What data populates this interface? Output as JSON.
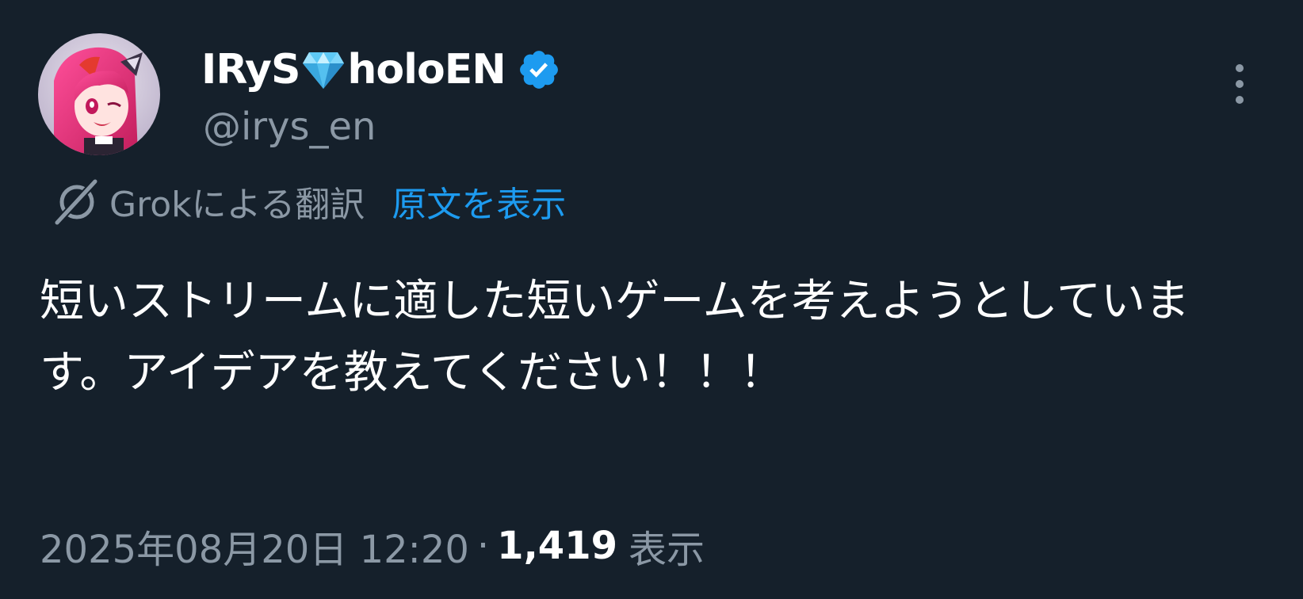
{
  "author": {
    "display_name_prefix": "IRyS",
    "display_name_emoji": "gem-stone-emoji",
    "display_name_suffix": "holoEN",
    "handle": "@irys_en",
    "verified": true,
    "verified_icon": "verified-badge-icon",
    "avatar_icon": "avatar"
  },
  "menu": {
    "icon": "more-vertical-icon"
  },
  "translation": {
    "icon": "grok-icon",
    "label": "Grokによる翻訳",
    "show_original_label": "原文を表示"
  },
  "tweet": {
    "text": "短いストリームに適した短いゲームを考えようとしています。アイデアを教えてください！！！"
  },
  "meta": {
    "timestamp": "2025年08月20日 12:20",
    "separator": "·",
    "view_count": "1,419",
    "view_label": "表示"
  },
  "colors": {
    "background": "#15202b",
    "primary_text": "#ffffff",
    "secondary_text": "#8b98a5",
    "link": "#1d9bf0",
    "verified": "#1d9bf0"
  }
}
